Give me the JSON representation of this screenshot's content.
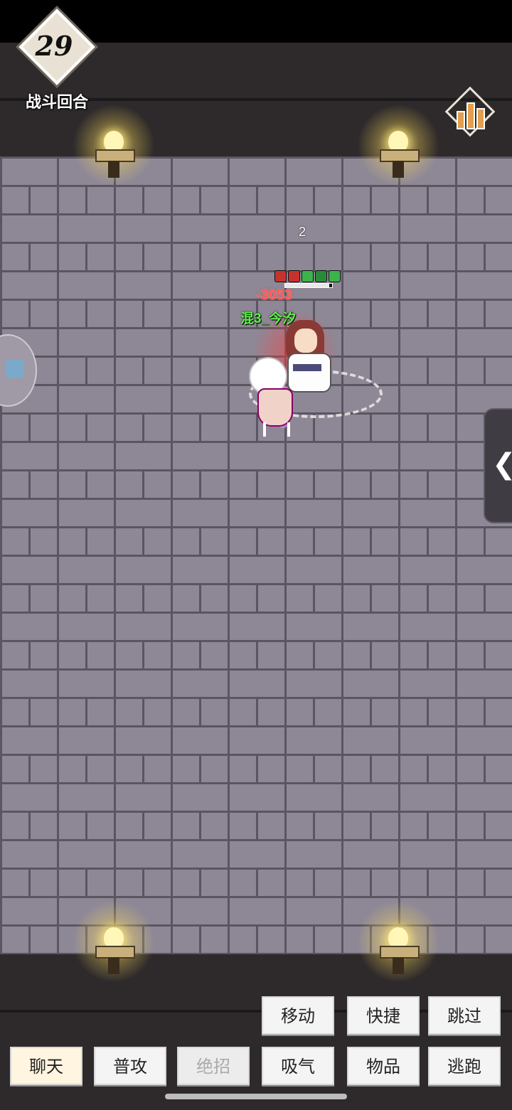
{
  "hud": {
    "round_number": "29",
    "round_label": "战斗回合",
    "stats_icon": "bar-chart-icon"
  },
  "battle": {
    "turn_number": "2",
    "damage_text": "-3053",
    "enemy_name": "混3_今汐",
    "enemy_hp_fraction": 0.94,
    "buffs": [
      {
        "icon": "red-debuff-icon",
        "color": "#c8322c"
      },
      {
        "icon": "red-debuff-icon",
        "color": "#c8322c"
      },
      {
        "icon": "green-buff-icon",
        "color": "#3bb34a"
      },
      {
        "icon": "shield-buff-icon",
        "color": "#2b8a3a"
      },
      {
        "icon": "green-buff-icon",
        "color": "#3bb34a"
      }
    ]
  },
  "side_panel": {
    "collapse_arrow": "❮"
  },
  "actions": {
    "move": "移动",
    "quick": "快捷",
    "skip": "跳过",
    "chat": "聊天",
    "attack": "普攻",
    "ultimate": "绝招",
    "breathe": "吸气",
    "items": "物品",
    "flee": "逃跑"
  },
  "colors": {
    "floor": "#8e8896",
    "mortar": "#5a5560",
    "wall": "#2e2a2b",
    "enemy_name": "#5ef04a",
    "damage": "#ff5555"
  }
}
